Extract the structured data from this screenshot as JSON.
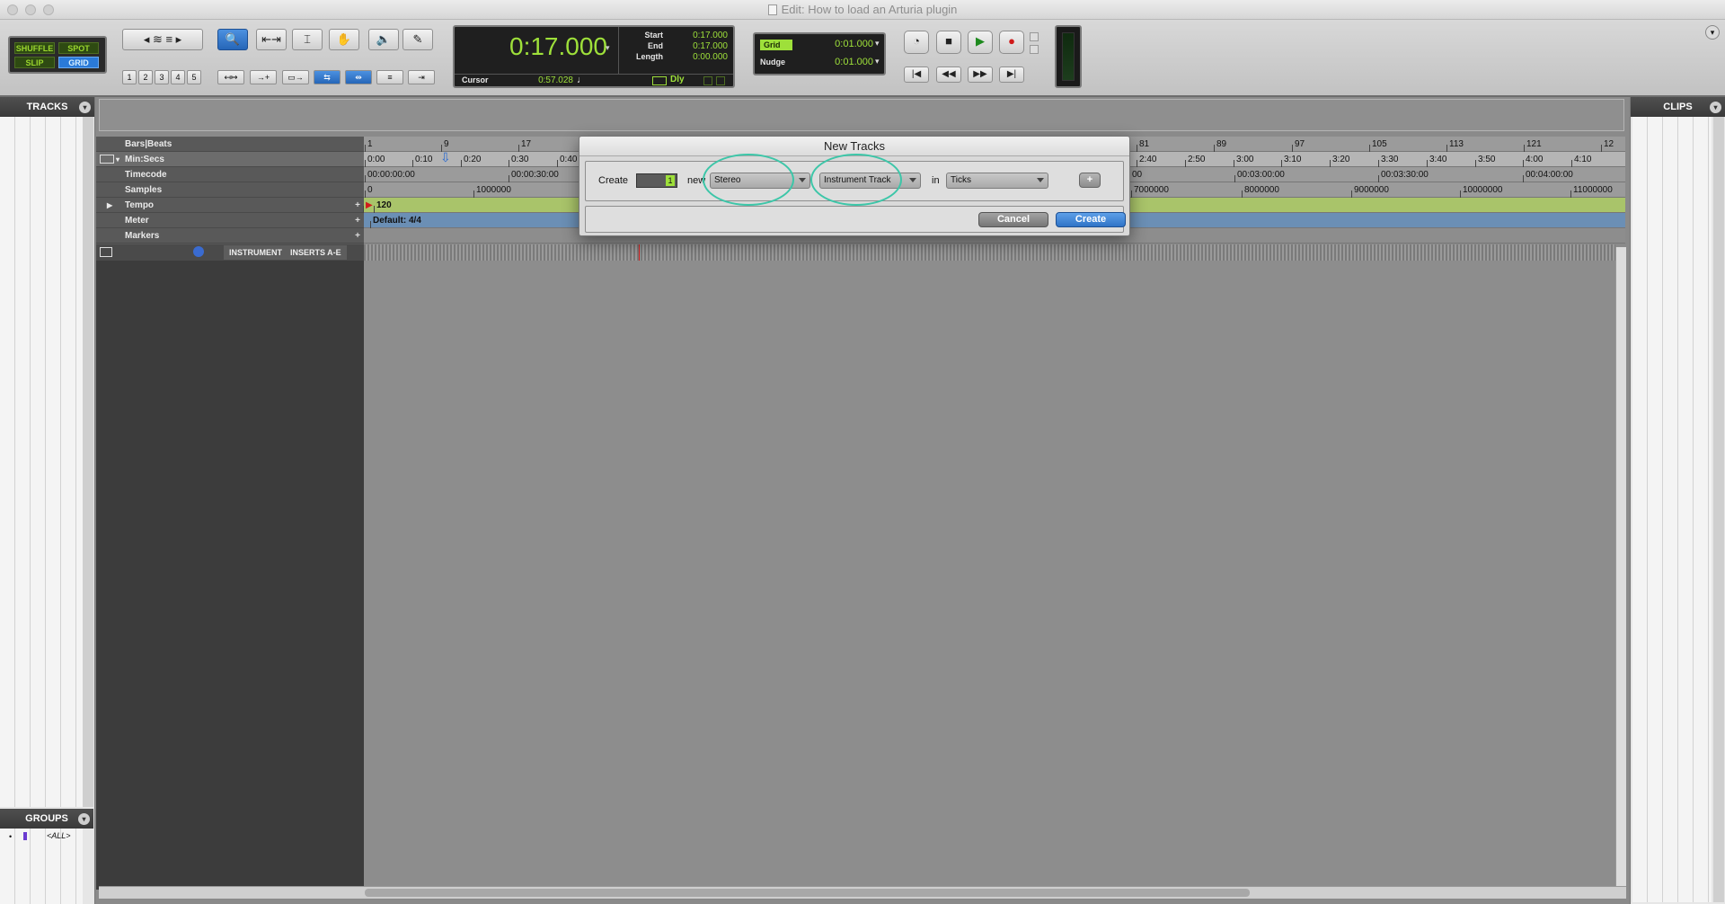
{
  "window": {
    "title": "Edit: How to load an Arturia plugin"
  },
  "toolbar": {
    "edit_modes": [
      "SHUFFLE",
      "SPOT",
      "SLIP",
      "GRID"
    ],
    "zoom_presets": [
      "1",
      "2",
      "3",
      "4",
      "5"
    ],
    "counter": {
      "main": "0:17.000",
      "start_label": "Start",
      "start_value": "0:17.000",
      "end_label": "End",
      "end_value": "0:17.000",
      "length_label": "Length",
      "length_value": "0:00.000",
      "cursor_label": "Cursor",
      "cursor_value": "0:57.028",
      "dly_label": "Dly"
    },
    "grid": {
      "label": "Grid",
      "value": "0:01.000"
    },
    "nudge": {
      "label": "Nudge",
      "value": "0:01.000"
    }
  },
  "sidebar": {
    "tracks_title": "TRACKS",
    "groups_title": "GROUPS",
    "groups_all": "<ALL>",
    "clips_title": "CLIPS"
  },
  "rulers": {
    "labels": [
      "Bars|Beats",
      "Min:Secs",
      "Timecode",
      "Samples",
      "Tempo",
      "Meter",
      "Markers"
    ],
    "bars": [
      "1",
      "9",
      "17",
      "81",
      "89",
      "97",
      "105",
      "113",
      "121",
      "12"
    ],
    "minsecs": [
      "0:00",
      "0:10",
      "0:20",
      "0:30",
      "0:40",
      "2:40",
      "2:50",
      "3:00",
      "3:10",
      "3:20",
      "3:30",
      "3:40",
      "3:50",
      "4:00",
      "4:10"
    ],
    "timecode": [
      "00:00:00:00",
      "00:00:30:00",
      "00",
      "00:03:00:00",
      "00:03:30:00",
      "00:04:00:00"
    ],
    "samples": [
      "0",
      "1000000",
      "7000000",
      "8000000",
      "9000000",
      "10000000",
      "11000000"
    ],
    "tempo_value": "120",
    "meter_value": "Default: 4/4"
  },
  "track_header": {
    "instrument_label": "INSTRUMENT",
    "inserts_label": "INSERTS A-E"
  },
  "dialog": {
    "title": "New Tracks",
    "create_label": "Create",
    "count_value": "1",
    "new_label": "new",
    "format_value": "Stereo",
    "type_value": "Instrument Track",
    "in_label": "in",
    "timebase_value": "Ticks",
    "add_label": "+",
    "cancel_label": "Cancel",
    "create_button_label": "Create"
  },
  "colors": {
    "lcd_green": "#9ee03a",
    "highlight_ring": "#3cc6a8",
    "tempo_bar": "#a9c46a",
    "meter_bar": "#6b8fb5",
    "create_button": "#2f74c7"
  }
}
